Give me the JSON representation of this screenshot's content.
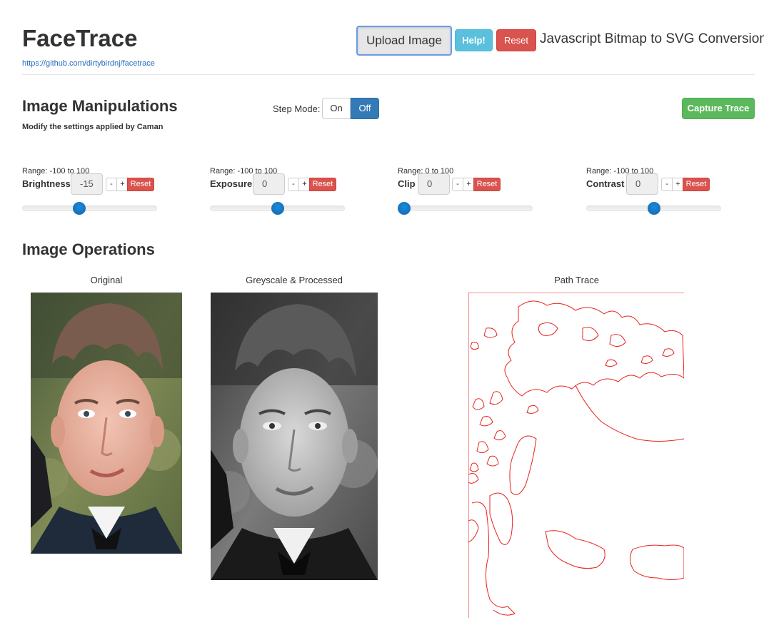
{
  "header": {
    "title": "FaceTrace",
    "link": "https://github.com/dirtybirdnj/facetrace",
    "upload_label": "Upload Image",
    "help_label": "Help!",
    "reset_label": "Reset",
    "tagline": "Javascript Bitmap to SVG Conversion."
  },
  "manipulations": {
    "heading": "Image Manipulations",
    "subheading": "Modify the settings applied by Caman",
    "step_mode_label": "Step Mode:",
    "step_on": "On",
    "step_off": "Off",
    "capture_label": "Capture Trace",
    "controls": [
      {
        "range": "Range: -100 to 100",
        "name": "Brightness",
        "value": "-15",
        "minus": "-",
        "plus": "+",
        "reset": "Reset",
        "level": 0.425
      },
      {
        "range": "Range: -100 to 100",
        "name": "Exposure",
        "value": "0",
        "minus": "-",
        "plus": "+",
        "reset": "Reset",
        "level": 0.5
      },
      {
        "range": "Range: 0 to 100",
        "name": "Clip",
        "value": "0",
        "minus": "-",
        "plus": "+",
        "reset": "Reset",
        "level": 0.0
      },
      {
        "range": "Range: -100 to 100",
        "name": "Contrast",
        "value": "0",
        "minus": "-",
        "plus": "+",
        "reset": "Reset",
        "level": 0.5
      }
    ]
  },
  "operations": {
    "heading": "Image Operations",
    "original_label": "Original",
    "processed_label": "Greyscale & Processed",
    "trace_label": "Path Trace"
  },
  "colors": {
    "trace_stroke": "#e8221e",
    "slider_handle": "#1a7cc7",
    "danger": "#d9534f",
    "info": "#5bc0de",
    "success": "#5cb85c",
    "primary": "#337ab7"
  }
}
